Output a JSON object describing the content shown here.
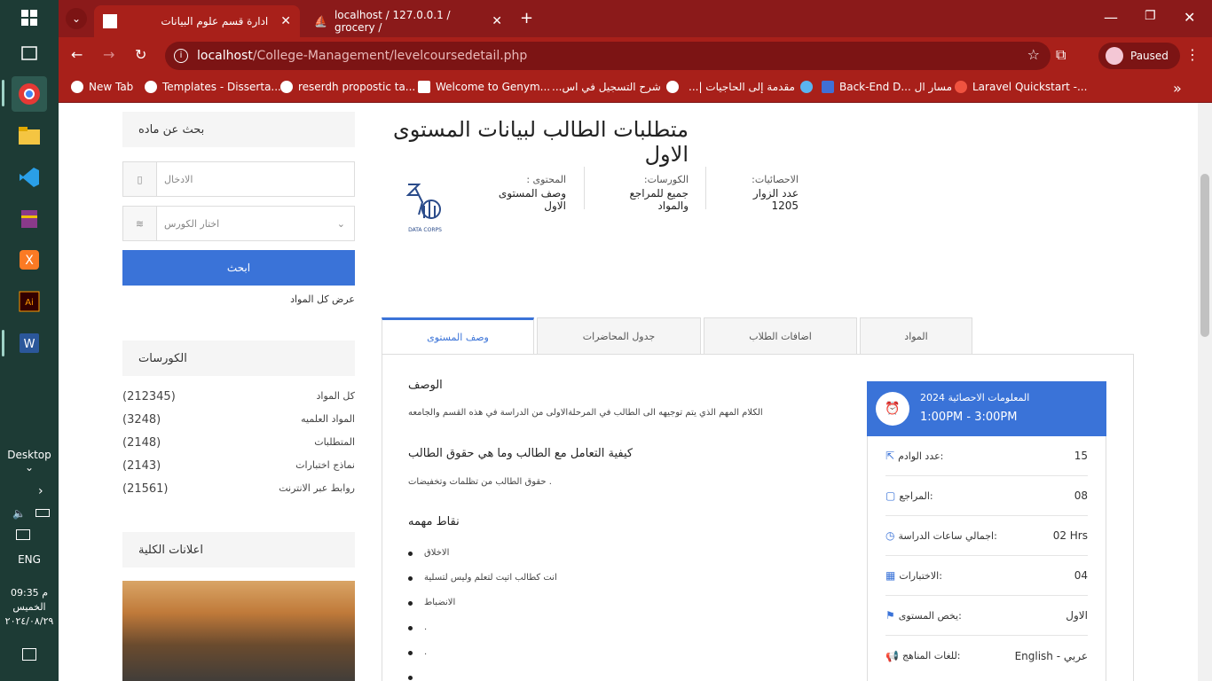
{
  "taskbar": {
    "desktop_label": "Desktop",
    "lang": "ENG",
    "clock_time": "09:35 م",
    "clock_day": "الخميس",
    "clock_date": "٢٠٢٤/٠٨/٢٩"
  },
  "browser": {
    "tabs": [
      {
        "label": "ادارة قسم علوم البيانات"
      },
      {
        "label": "localhost / 127.0.0.1 / grocery /"
      }
    ],
    "url_host": "localhost",
    "url_path": "/College-Management/levelcoursedetail.php",
    "profile_label": "Paused",
    "bookmarks": [
      {
        "label": "New Tab"
      },
      {
        "label": "Templates - Disserta..."
      },
      {
        "label": "reserdh propostic ta..."
      },
      {
        "label": "Welcome to Genym..."
      },
      {
        "label": "شرح التسجيل في اس..."
      },
      {
        "label": "مقدمة إلى الحاجيات |..."
      },
      {
        "label": "Back-End D... مسار ال"
      },
      {
        "label": "Laravel Quickstart -..."
      }
    ]
  },
  "sidebar": {
    "search_title": "بحث عن ماده",
    "input_placeholder": "الادخال",
    "select_value": "اختار الكورس",
    "search_button": "ابحث",
    "show_all": "عرض كل المواد",
    "courses_title": "الكورسات",
    "categories": [
      {
        "label": "كل المواد",
        "count": "(212345)"
      },
      {
        "label": "المواد العلميه",
        "count": "(3248)"
      },
      {
        "label": "المتطلبات",
        "count": "(2148)"
      },
      {
        "label": "نماذج اختبارات",
        "count": "(2143)"
      },
      {
        "label": "روابط عبر الانترنت",
        "count": "(21561)"
      }
    ],
    "announcements_title": "اعلانات الكلية"
  },
  "main": {
    "title": "متطلبات الطالب لبيانات المستوى الاول",
    "meta": [
      {
        "label": "الاحصائيات:",
        "value": "عدد الزوار 1205"
      },
      {
        "label": "الكورسات:",
        "value": "جميع للمراجع والمواد"
      },
      {
        "label": "المحتوى :",
        "value": "وصف المستوى الاول"
      }
    ],
    "logo_text": "DATA CORPS",
    "tabs": [
      "المواد",
      "اضافات الطلاب",
      "جدول المحاضرات",
      "وصف المستوى"
    ],
    "desc_heading": "الوصف",
    "desc_text": "الكلام المهم الذي يتم توجيهه الى الطالب في المرحلةالاولى من الدراسة في هذه القسم والجامعه",
    "rights_heading": "كيفية التعامل مع الطالب وما هي حقوق الطالب",
    "rights_text": "حقوق الطالب من تظلمات وتخفيضات .",
    "points_heading": "نقاط مهمه",
    "points": [
      "الاخلاق",
      "انت كطالب اتيت لتعلم وليس لتسلية",
      "الانضباط",
      ".",
      ".",
      ""
    ]
  },
  "info_card": {
    "title": "المعلومات الاحصائية 2024",
    "time": "1:00PM - 3:00PM",
    "rows": [
      {
        "label": "عدد الوادم:",
        "value": "15",
        "icon": "cursor-icon"
      },
      {
        "label": "المراجع:",
        "value": "08",
        "icon": "book-icon"
      },
      {
        "label": "اجمالي ساعات الدراسة:",
        "value": "02 Hrs",
        "icon": "clock-icon"
      },
      {
        "label": "الاختبارات:",
        "value": "04",
        "icon": "grid-icon"
      },
      {
        "label": "يخص المستوى:",
        "value": "الاول",
        "icon": "bookmark-icon"
      },
      {
        "label": "للغات المناهج:",
        "value": "English - عربي",
        "icon": "megaphone-icon"
      }
    ]
  },
  "colors": {
    "accent": "#3a73d8",
    "browser": "#a8201a",
    "taskbar": "#1d3b35"
  }
}
